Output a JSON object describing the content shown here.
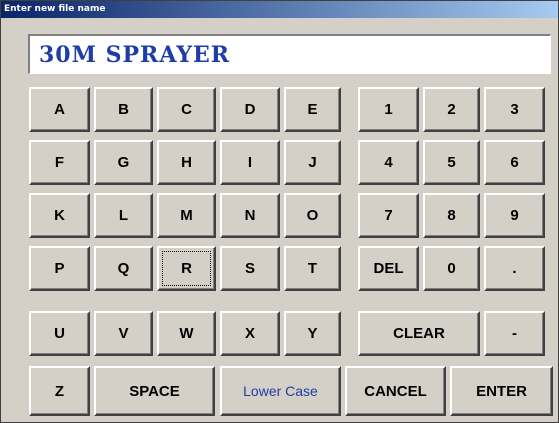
{
  "window": {
    "title": "Enter new file name"
  },
  "file_name": {
    "value": "30M SPRAYER"
  },
  "letters": [
    "A",
    "B",
    "C",
    "D",
    "E",
    "F",
    "G",
    "H",
    "I",
    "J",
    "K",
    "L",
    "M",
    "N",
    "O",
    "P",
    "Q",
    "R",
    "S",
    "T",
    "U",
    "V",
    "W",
    "X",
    "Y",
    "Z"
  ],
  "digits": [
    "1",
    "2",
    "3",
    "4",
    "5",
    "6",
    "7",
    "8",
    "9",
    "0"
  ],
  "keys": {
    "del": "DEL",
    "dot": ".",
    "clear": "CLEAR",
    "dash": "-",
    "space": "SPACE",
    "lower_case": "Lower Case",
    "cancel": "CANCEL",
    "enter": "ENTER"
  },
  "focused_key": "R",
  "colors": {
    "title_bar": "#0a246a",
    "input_text": "#1e3da8",
    "lower_case_text": "#1e3da8",
    "face": "#d4d0c8"
  }
}
